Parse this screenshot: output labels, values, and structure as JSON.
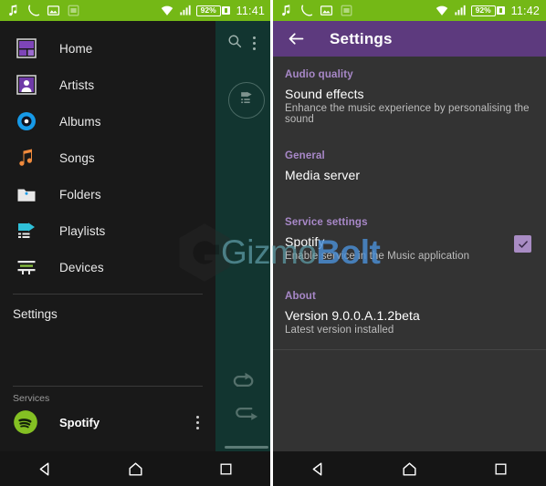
{
  "left_phone": {
    "statusbar": {
      "icons": [
        "music-note-icon",
        "phone-call-icon",
        "image-icon",
        "sim-card-icon"
      ],
      "wifi_icon": "wifi-icon",
      "signal_icon": "signal-bars-icon",
      "battery_text": "92%",
      "battery_icon": "battery-charging-icon",
      "time": "11:41"
    },
    "drawer": {
      "items": [
        {
          "label": "Home",
          "icon": "home-grid-icon"
        },
        {
          "label": "Artists",
          "icon": "artist-person-icon"
        },
        {
          "label": "Albums",
          "icon": "album-disc-icon"
        },
        {
          "label": "Songs",
          "icon": "music-note-icon"
        },
        {
          "label": "Folders",
          "icon": "folder-icon"
        },
        {
          "label": "Playlists",
          "icon": "playlist-play-icon"
        },
        {
          "label": "Devices",
          "icon": "devices-icon"
        }
      ],
      "settings_label": "Settings",
      "services_label": "Services",
      "service": {
        "name": "Spotify",
        "icon": "spotify-icon",
        "overflow_icon": "kebab-menu-icon"
      }
    },
    "strip": {
      "search_icon": "search-icon",
      "overflow_icon": "kebab-menu-icon",
      "queue_icon": "playlist-queue-icon",
      "shuffle_icon": "shuffle-icon",
      "repeat_icon": "repeat-icon"
    },
    "navbar": {
      "back": "back-triangle-icon",
      "home": "home-pentagon-icon",
      "recents": "recents-square-icon"
    }
  },
  "right_phone": {
    "statusbar": {
      "icons": [
        "music-note-icon",
        "phone-call-icon",
        "image-icon",
        "sim-card-icon"
      ],
      "wifi_icon": "wifi-icon",
      "signal_icon": "signal-bars-icon",
      "battery_text": "92%",
      "battery_icon": "battery-charging-icon",
      "time": "11:42"
    },
    "appbar": {
      "back_icon": "arrow-back-icon",
      "title": "Settings"
    },
    "sections": [
      {
        "header": "Audio quality",
        "items": [
          {
            "title": "Sound effects",
            "subtitle": "Enhance the music experience by personalising the sound",
            "checkbox": null
          }
        ]
      },
      {
        "header": "General",
        "items": [
          {
            "title": "Media server",
            "subtitle": "",
            "checkbox": null
          }
        ]
      },
      {
        "header": "Service settings",
        "items": [
          {
            "title": "Spotify",
            "subtitle": "Enable service in the Music application",
            "checkbox": "checked"
          }
        ]
      },
      {
        "header": "About",
        "items": [
          {
            "title": "Version 9.0.0.A.1.2beta",
            "subtitle": "Latest version installed",
            "checkbox": null
          }
        ]
      }
    ],
    "navbar": {
      "back": "back-triangle-icon",
      "home": "home-pentagon-icon",
      "recents": "recents-square-icon"
    }
  },
  "watermark": {
    "logo_icon": "gizmobolt-hexagon-g-icon",
    "part1": "Gizmo",
    "part2": "Bolt"
  },
  "colors": {
    "statusbar_green": "#74b816",
    "appbar_purple": "#5d3a7e",
    "drawer_bg": "#191919",
    "settings_bg": "#333333",
    "strip_teal": "#123530",
    "section_header": "#a888c8",
    "checkbox": "#a98cc4",
    "spotify_green": "#84c023"
  }
}
